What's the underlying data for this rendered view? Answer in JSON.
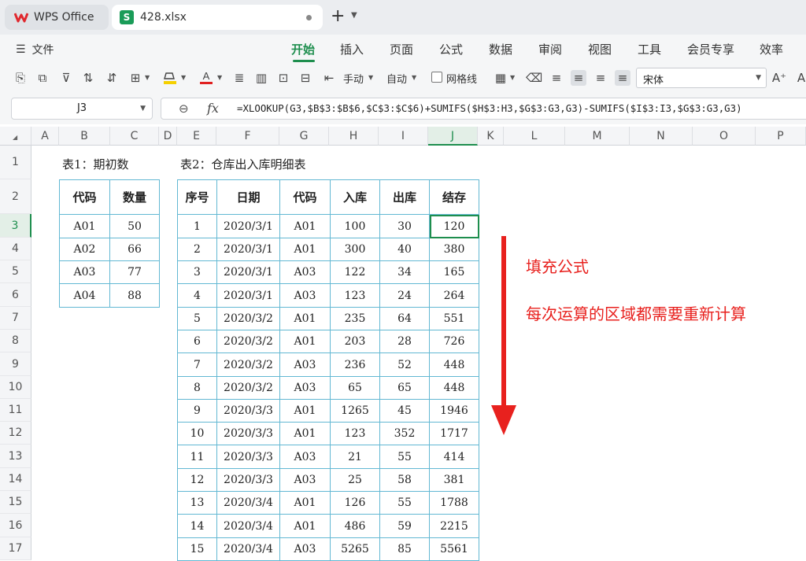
{
  "tabs": {
    "app": "WPS Office",
    "file": "428.xlsx",
    "sheet_icon_letter": "S"
  },
  "menu": {
    "file_label": "文件",
    "items": [
      "开始",
      "插入",
      "页面",
      "公式",
      "数据",
      "审阅",
      "视图",
      "工具",
      "会员专享",
      "效率"
    ],
    "active": "开始"
  },
  "toolbar": {
    "manual_label": "手动",
    "auto_label": "自动",
    "gridlines_label": "网格线",
    "font_name": "宋体",
    "font_color": "#e02020",
    "fill_color": "#f5d000"
  },
  "formula_bar": {
    "cell_ref": "J3",
    "fx_label": "fx",
    "formula": "=XLOOKUP(G3,$B$3:$B$6,$C$3:$C$6)+SUMIFS($H$3:H3,$G$3:G3,G3)-SUMIFS($I$3:I3,$G$3:G3,G3)"
  },
  "columns": [
    "A",
    "B",
    "C",
    "D",
    "E",
    "F",
    "G",
    "H",
    "I",
    "J",
    "K",
    "L",
    "M",
    "N",
    "O",
    "P"
  ],
  "selected_column": "J",
  "rows": [
    "1",
    "2",
    "3",
    "4",
    "5",
    "6",
    "7",
    "8",
    "9",
    "10",
    "11",
    "12",
    "13",
    "14",
    "15",
    "16",
    "17"
  ],
  "selected_row": "3",
  "sheet": {
    "table1_title": "表1：期初数",
    "table2_title": "表2：仓库出入库明细表",
    "table1": {
      "headers": [
        "代码",
        "数量"
      ],
      "rows": [
        [
          "A01",
          "50"
        ],
        [
          "A02",
          "66"
        ],
        [
          "A03",
          "77"
        ],
        [
          "A04",
          "88"
        ]
      ]
    },
    "table2": {
      "headers": [
        "序号",
        "日期",
        "代码",
        "入库",
        "出库",
        "结存"
      ],
      "rows": [
        [
          "1",
          "2020/3/1",
          "A01",
          "100",
          "30",
          "120"
        ],
        [
          "2",
          "2020/3/1",
          "A01",
          "300",
          "40",
          "380"
        ],
        [
          "3",
          "2020/3/1",
          "A03",
          "122",
          "34",
          "165"
        ],
        [
          "4",
          "2020/3/1",
          "A03",
          "123",
          "24",
          "264"
        ],
        [
          "5",
          "2020/3/2",
          "A01",
          "235",
          "64",
          "551"
        ],
        [
          "6",
          "2020/3/2",
          "A01",
          "203",
          "28",
          "726"
        ],
        [
          "7",
          "2020/3/2",
          "A03",
          "236",
          "52",
          "448"
        ],
        [
          "8",
          "2020/3/2",
          "A03",
          "65",
          "65",
          "448"
        ],
        [
          "9",
          "2020/3/3",
          "A01",
          "1265",
          "45",
          "1946"
        ],
        [
          "10",
          "2020/3/3",
          "A01",
          "123",
          "352",
          "1717"
        ],
        [
          "11",
          "2020/3/3",
          "A03",
          "21",
          "55",
          "414"
        ],
        [
          "12",
          "2020/3/3",
          "A03",
          "25",
          "58",
          "381"
        ],
        [
          "13",
          "2020/3/4",
          "A01",
          "126",
          "55",
          "1788"
        ],
        [
          "14",
          "2020/3/4",
          "A01",
          "486",
          "59",
          "2215"
        ],
        [
          "15",
          "2020/3/4",
          "A03",
          "5265",
          "85",
          "5561"
        ]
      ]
    }
  },
  "annotations": {
    "line1": "填充公式",
    "line2": "每次运算的区域都需要重新计算",
    "color": "#e8211e"
  }
}
